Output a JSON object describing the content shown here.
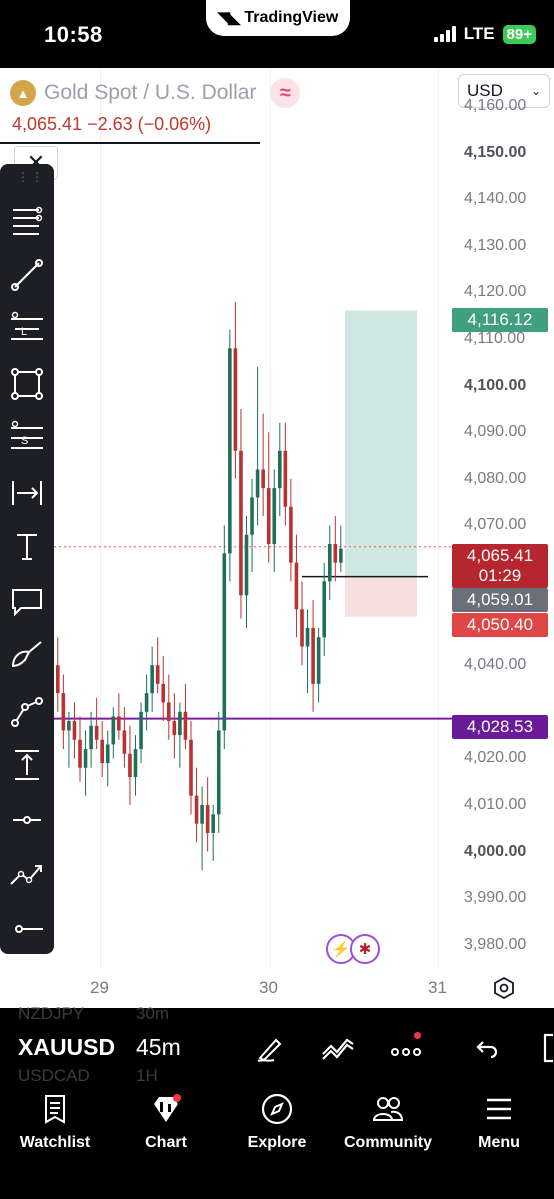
{
  "status_bar": {
    "time": "10:58",
    "brand": "TradingView",
    "network": "LTE",
    "battery": "89+"
  },
  "chart_header": {
    "symbol_title": "Gold Spot / U.S. Dollar",
    "price_line": "4,065.41  −2.63 (−0.06%)",
    "currency_select": "USD"
  },
  "price_axis": {
    "labels": [
      {
        "text": "4,160.00",
        "bold": false
      },
      {
        "text": "4,150.00",
        "bold": true
      },
      {
        "text": "4,140.00",
        "bold": false
      },
      {
        "text": "4,130.00",
        "bold": false
      },
      {
        "text": "4,120.00",
        "bold": false
      },
      {
        "text": "4,110.00",
        "bold": false
      },
      {
        "text": "4,100.00",
        "bold": true
      },
      {
        "text": "4,090.00",
        "bold": false
      },
      {
        "text": "4,080.00",
        "bold": false
      },
      {
        "text": "4,070.00",
        "bold": false
      },
      {
        "text": "4,040.00",
        "bold": false
      },
      {
        "text": "4,020.00",
        "bold": false
      },
      {
        "text": "4,010.00",
        "bold": false
      },
      {
        "text": "4,000.00",
        "bold": true
      },
      {
        "text": "3,990.00",
        "bold": false
      },
      {
        "text": "3,980.00",
        "bold": false
      }
    ],
    "tags": {
      "take_profit": "4,116.12",
      "last_price": "4,065.41",
      "countdown": "01:29",
      "entry": "4,059.01",
      "stop_loss": "4,050.40",
      "support_line": "4,028.53"
    }
  },
  "time_axis": {
    "labels": [
      "29",
      "30",
      "31"
    ]
  },
  "colors": {
    "up": "#26a69a",
    "down": "#ef5350",
    "up_dark": "#1f6f5a",
    "down_dark": "#b83232",
    "profit_zone": "#cfe8e4",
    "loss_zone": "#f9dede",
    "support": "#7b1fa2",
    "tag_green": "#3f9f7f",
    "tag_red": "#e04646",
    "tag_gray": "#6b6f7a",
    "tag_last": "#b5262f"
  },
  "drawing_tools": [
    {
      "icon": "horizontal-lines-icon"
    },
    {
      "icon": "trend-line-icon"
    },
    {
      "icon": "fib-retracement-icon"
    },
    {
      "icon": "rectangle-icon"
    },
    {
      "icon": "pattern-icon"
    },
    {
      "icon": "measure-icon"
    },
    {
      "icon": "text-icon"
    },
    {
      "icon": "comment-icon"
    },
    {
      "icon": "brush-icon"
    },
    {
      "icon": "path-icon"
    },
    {
      "icon": "price-range-icon"
    },
    {
      "icon": "ray-icon"
    },
    {
      "icon": "forecast-icon"
    },
    {
      "icon": "horizontal-ray-icon"
    }
  ],
  "symbol_bar": {
    "ghost_above": {
      "symbol": "NZDJPY",
      "tf": "30m"
    },
    "current": {
      "symbol": "XAUUSD",
      "tf": "45m"
    },
    "ghost_below": {
      "symbol": "USDCAD",
      "tf": "1H"
    }
  },
  "bottom_nav": [
    {
      "label": "Watchlist",
      "icon": "watchlist-icon"
    },
    {
      "label": "Chart",
      "icon": "chart-icon"
    },
    {
      "label": "Explore",
      "icon": "compass-icon"
    },
    {
      "label": "Community",
      "icon": "people-icon"
    },
    {
      "label": "Menu",
      "icon": "hamburger-icon"
    }
  ]
}
